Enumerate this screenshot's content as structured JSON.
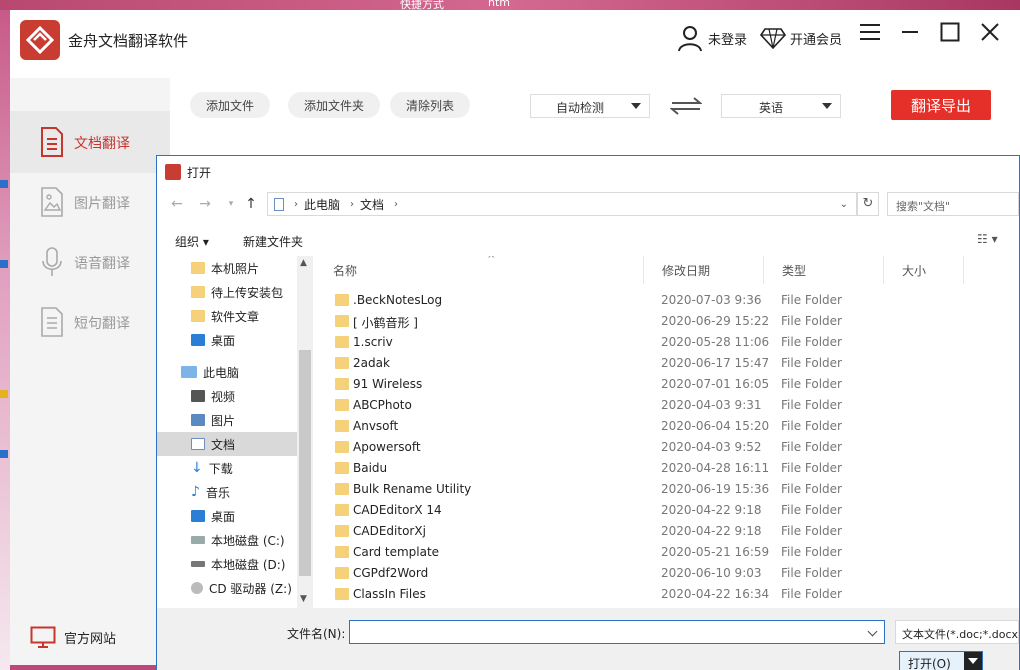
{
  "desktop": {
    "label1": "快捷方式",
    "label2": "htm"
  },
  "app": {
    "title": "金舟文档翻译软件",
    "login": "未登录",
    "vip": "开通会员"
  },
  "sidebar": {
    "items": [
      {
        "label": "文档翻译"
      },
      {
        "label": "图片翻译"
      },
      {
        "label": "语音翻译"
      },
      {
        "label": "短句翻译"
      }
    ],
    "official": "官方网站"
  },
  "toolbar": {
    "add_file": "添加文件",
    "add_folder": "添加文件夹",
    "clear_list": "清除列表",
    "source_lang": "自动检测",
    "target_lang": "英语",
    "export": "翻译导出"
  },
  "dialog": {
    "title": "打开",
    "address": [
      "此电脑",
      "文档"
    ],
    "search_placeholder": "搜索\"文档\"",
    "organize": "组织",
    "new_folder": "新建文件夹",
    "nav": [
      {
        "label": "本机照片",
        "kind": "folder"
      },
      {
        "label": "待上传安装包",
        "kind": "folder"
      },
      {
        "label": "软件文章",
        "kind": "folder"
      },
      {
        "label": "桌面",
        "kind": "desktop"
      },
      {
        "label": "此电脑",
        "kind": "pc"
      },
      {
        "label": "视频",
        "kind": "video"
      },
      {
        "label": "图片",
        "kind": "pictures"
      },
      {
        "label": "文档",
        "kind": "docs"
      },
      {
        "label": "下载",
        "kind": "download"
      },
      {
        "label": "音乐",
        "kind": "music"
      },
      {
        "label": "桌面",
        "kind": "desktop"
      },
      {
        "label": "本地磁盘 (C:)",
        "kind": "drive"
      },
      {
        "label": "本地磁盘 (D:)",
        "kind": "drive"
      },
      {
        "label": "CD 驱动器 (Z:)",
        "kind": "cd"
      }
    ],
    "columns": {
      "name": "名称",
      "date": "修改日期",
      "type": "类型",
      "size": "大小"
    },
    "files": [
      {
        "name": ".BeckNotesLog",
        "date": "2020-07-03 9:36",
        "type": "File Folder"
      },
      {
        "name": "[ 小鹤音形 ]",
        "date": "2020-06-29 15:22",
        "type": "File Folder"
      },
      {
        "name": "1.scriv",
        "date": "2020-05-28 11:06",
        "type": "File Folder"
      },
      {
        "name": "2adak",
        "date": "2020-06-17 15:47",
        "type": "File Folder"
      },
      {
        "name": "91 Wireless",
        "date": "2020-07-01 16:05",
        "type": "File Folder"
      },
      {
        "name": "ABCPhoto",
        "date": "2020-04-03 9:31",
        "type": "File Folder"
      },
      {
        "name": "Anvsoft",
        "date": "2020-06-04 15:20",
        "type": "File Folder"
      },
      {
        "name": "Apowersoft",
        "date": "2020-04-03 9:52",
        "type": "File Folder"
      },
      {
        "name": "Baidu",
        "date": "2020-04-28 16:11",
        "type": "File Folder"
      },
      {
        "name": "Bulk Rename Utility",
        "date": "2020-06-19 15:36",
        "type": "File Folder"
      },
      {
        "name": "CADEditorX 14",
        "date": "2020-04-22 9:18",
        "type": "File Folder"
      },
      {
        "name": "CADEditorXj",
        "date": "2020-04-22 9:18",
        "type": "File Folder"
      },
      {
        "name": "Card template",
        "date": "2020-05-21 16:59",
        "type": "File Folder"
      },
      {
        "name": "CGPdf2Word",
        "date": "2020-06-10 9:03",
        "type": "File Folder"
      },
      {
        "name": "ClassIn Files",
        "date": "2020-04-22 16:34",
        "type": "File Folder"
      }
    ],
    "filename_label": "文件名(N):",
    "filename_value": "",
    "filetype": "文本文件(*.doc;*.docx",
    "open_button": "打开(O)"
  }
}
